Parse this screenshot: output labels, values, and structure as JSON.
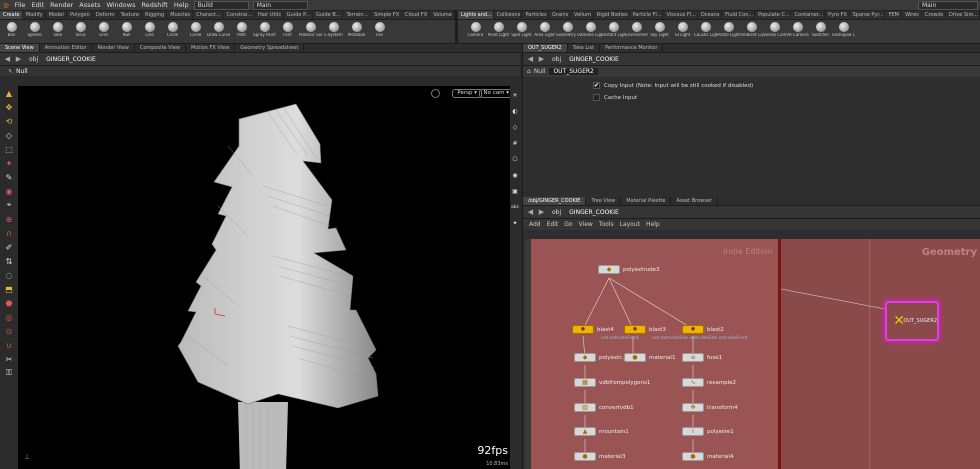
{
  "menu": {
    "items": [
      "File",
      "Edit",
      "Render",
      "Assets",
      "Windows",
      "Redshift",
      "Help"
    ],
    "desktop": "Build",
    "context": "Main",
    "context_right": "Main"
  },
  "shelf_tabs_left": [
    "Create",
    "Modify",
    "Model",
    "Polygon",
    "Deform",
    "Texture",
    "Rigging",
    "Muscles",
    "Charact...",
    "Constrai...",
    "Hair Utils",
    "Guide P...",
    "Guide B...",
    "Terrain...",
    "Simple FX",
    "Cloud FX",
    "Volume"
  ],
  "shelf_tabs_right": [
    "Lights and...",
    "Collisions",
    "Particles",
    "Grains",
    "Vellum",
    "Rigid Bodies",
    "Particle Fl...",
    "Viscous Fl...",
    "Oceans",
    "Fluid Con...",
    "Populate C...",
    "Container...",
    "Pyro FX",
    "Sparse Pyr...",
    "FEM",
    "Wires",
    "Crowds",
    "Drive Sim..."
  ],
  "tools_left": [
    "Box",
    "Sphere",
    "Tube",
    "Torus",
    "Grid",
    "Null",
    "Line",
    "Circle",
    "Curve",
    "Draw Curve",
    "Path",
    "Spray Paint",
    "Font",
    "Platonic Solids",
    "L-System",
    "Metaball",
    "File"
  ],
  "tools_right": [
    "Camera",
    "Point Light",
    "Spot Light",
    "Area Light",
    "Geometry Light",
    "Volume Light",
    "Distant Light",
    "Environment Light",
    "Sky Light",
    "GI Light",
    "Caustic Light",
    "Portal Light",
    "Ambient Light",
    "Stereo Camera",
    "VR Camera",
    "Switcher",
    "Gamepad Camera"
  ],
  "left_pane": {
    "tabs": [
      "Scene View",
      "Animation Editor",
      "Render View",
      "Composite View",
      "Motion FX View",
      "Geometry Spreadsheet"
    ],
    "path": [
      "obj",
      "GINGER_COOKIE"
    ],
    "op_label": "Null",
    "persp": "Persp",
    "cam": "No cam",
    "fps": "92fps",
    "fps_sub": "10.83ms"
  },
  "param_pane": {
    "tabs": [
      "OUT_SUGER2",
      "Take List",
      "Performance Monitor"
    ],
    "path": [
      "obj",
      "GINGER_COOKIE"
    ],
    "node_type": "Null",
    "node_name": "OUT_SUGER2",
    "params": [
      {
        "label": "Copy Input (Note: Input will be still cooked if disabled)",
        "checked": true
      },
      {
        "label": "Cache Input",
        "checked": false
      }
    ]
  },
  "network_pane": {
    "tabs": [
      "/obj/GINGER_COOKIE",
      "Tree View",
      "Material Palette",
      "Asset Browser"
    ],
    "path": [
      "obj",
      "GINGER_COOKIE"
    ],
    "menu": [
      "Add",
      "Edit",
      "Go",
      "View",
      "Tools",
      "Layout",
      "Help"
    ],
    "watermark": "Indie Edition",
    "context_label": "Geometry",
    "nodes": {
      "polyextrude3": "polyextrude3",
      "blast4": "blast4",
      "blast3": "blast3",
      "blast2": "blast2",
      "sub_blast4": "not extrudeFront",
      "sub_blast3": "not extrudeSide",
      "sub_blast2": "extrudeSide extrudeFront",
      "polyextr": "polyextr...",
      "material1": "material1",
      "fuse1": "fuse1",
      "vdbfrompolygons1": "vdbfrompolygons1",
      "resample2": "resample2",
      "convertvdb1": "convertvdb1",
      "transform4": "transform4",
      "mountain1": "mountain1",
      "polywire1": "polywire1",
      "material3": "material3",
      "material4": "material4",
      "out": "OUT_SUGER2"
    }
  }
}
